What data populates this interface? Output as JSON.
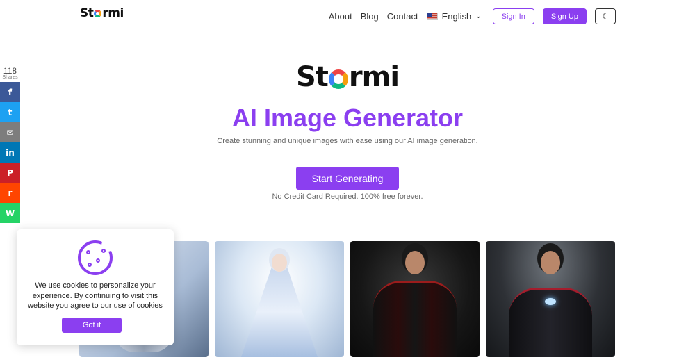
{
  "header": {
    "logo_text": "Stormi",
    "nav": [
      "About",
      "Blog",
      "Contact"
    ],
    "language": "English",
    "sign_in": "Sign In",
    "sign_up": "Sign Up",
    "theme_icon": "moon-icon"
  },
  "share": {
    "count": "118",
    "label": "Shares",
    "buttons": [
      {
        "name": "facebook",
        "glyph": "f",
        "color": "#3b5998"
      },
      {
        "name": "twitter",
        "glyph": "t",
        "color": "#1da1f2"
      },
      {
        "name": "email",
        "glyph": "✉",
        "color": "#7d7d7d"
      },
      {
        "name": "linkedin",
        "glyph": "in",
        "color": "#0077b5"
      },
      {
        "name": "pinterest",
        "glyph": "P",
        "color": "#cb2027"
      },
      {
        "name": "reddit",
        "glyph": "r",
        "color": "#ff4500"
      },
      {
        "name": "whatsapp",
        "glyph": "W",
        "color": "#25d366"
      }
    ]
  },
  "hero": {
    "logo_text": "Stormi",
    "title": "AI Image Generator",
    "subtitle": "Create stunning and unique images with ease using our AI image generation.",
    "cta": "Start Generating",
    "note": "No Credit Card Required. 100% free forever."
  },
  "cookie": {
    "text": "We use cookies to personalize your experience. By continuing to visit this website you agree to our use of cookies",
    "button": "Got it"
  },
  "colors": {
    "accent": "#8b3ff0"
  }
}
